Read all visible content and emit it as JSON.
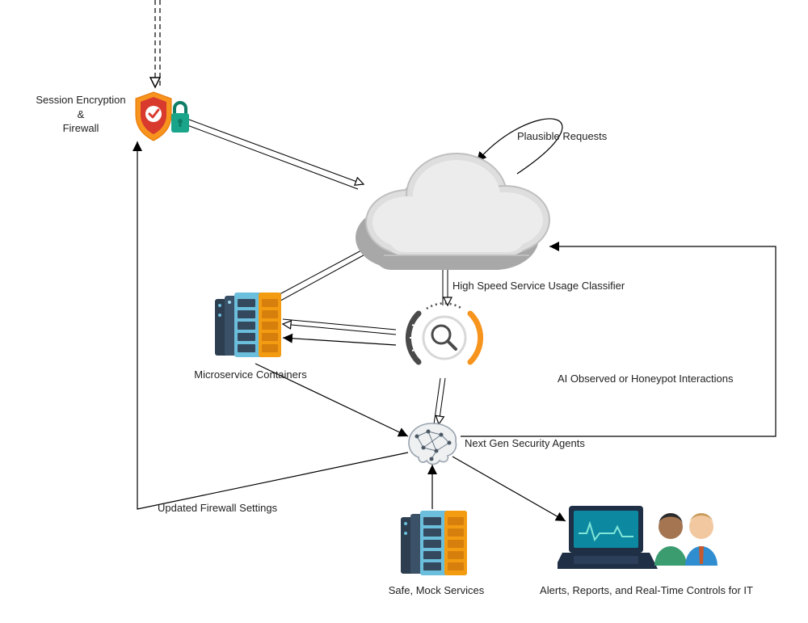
{
  "diagram": {
    "nodes": {
      "firewall": {
        "label": "Session Encryption\n&\nFirewall"
      },
      "cloud": {
        "label": ""
      },
      "plausible_requests": {
        "label": "Plausible Requests"
      },
      "classifier_label": {
        "label": "High Speed Service Usage Classifier"
      },
      "microservices": {
        "label": "Microservice Containers"
      },
      "ai_brain": {
        "label": "Next Gen Security Agents"
      },
      "honeypot_label": {
        "label": "AI Observed or Honeypot Interactions"
      },
      "safe_mock": {
        "label": "Safe, Mock Services"
      },
      "laptop_users": {
        "label": "Alerts, Reports, and Real-Time Controls for IT"
      },
      "firewall_update": {
        "label": "Updated Firewall Settings"
      }
    },
    "colors": {
      "orange": "#f7941e",
      "orange_dark": "#e57400",
      "red": "#d83a2e",
      "teal": "#1aa58b",
      "teal_dark": "#0f7d68",
      "dark_gray": "#4a4a4a",
      "cloud_gray": "#dedede",
      "cloud_shadow": "#a8a8a8",
      "server_body": "#6bbedc",
      "server_body_dark": "#2c3e50",
      "server_accent": "#f39c12",
      "laptop_body": "#1f2f45",
      "laptop_screen": "#0c88a0",
      "person1_skin": "#a57551",
      "person1_shirt": "#3a9c6f",
      "person2_skin": "#f2c8a0",
      "person2_shirt": "#2f8dd0",
      "person2_tie": "#c65a2e",
      "person2_hair": "#c89b5a"
    }
  }
}
